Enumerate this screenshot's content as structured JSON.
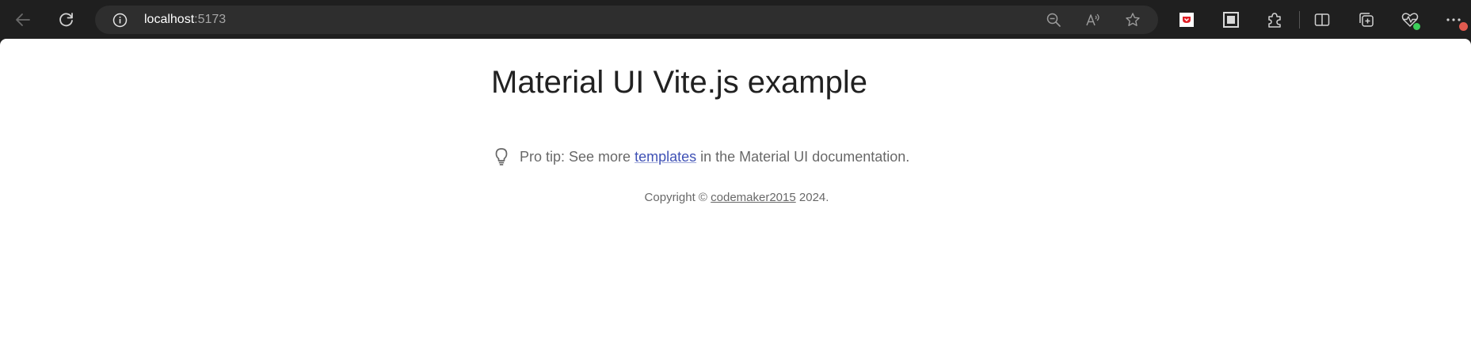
{
  "browser": {
    "url_host": "localhost",
    "url_port": ":5173",
    "icons": {
      "back": "arrow-left-icon",
      "refresh": "refresh-icon",
      "site_info": "info-icon",
      "zoom": "zoom-out-icon",
      "read_aloud": "read-aloud-icon",
      "favorite": "star-icon",
      "extensions": "puzzle-icon",
      "split_screen": "split-screen-icon",
      "collections": "collections-icon",
      "performance": "heartbeat-icon",
      "more": "ellipsis-icon"
    },
    "colors": {
      "toolbar": "#1f1f1f",
      "address_bar": "#2e2e2e",
      "extension_red": "#e11f26",
      "badge_green": "#3ccf5a",
      "badge_red": "#e05a4f"
    }
  },
  "page": {
    "title": "Material UI Vite.js example",
    "protip": {
      "prefix": "Pro tip: See more ",
      "link": "templates",
      "suffix": " in the Material UI documentation."
    },
    "copyright": {
      "prefix": "Copyright © ",
      "link": "codemaker2015",
      "suffix": " 2024."
    },
    "colors": {
      "link": "#3f51b5",
      "text_secondary": "rgba(0,0,0,0.6)",
      "text_primary": "rgba(0,0,0,0.87)"
    }
  }
}
